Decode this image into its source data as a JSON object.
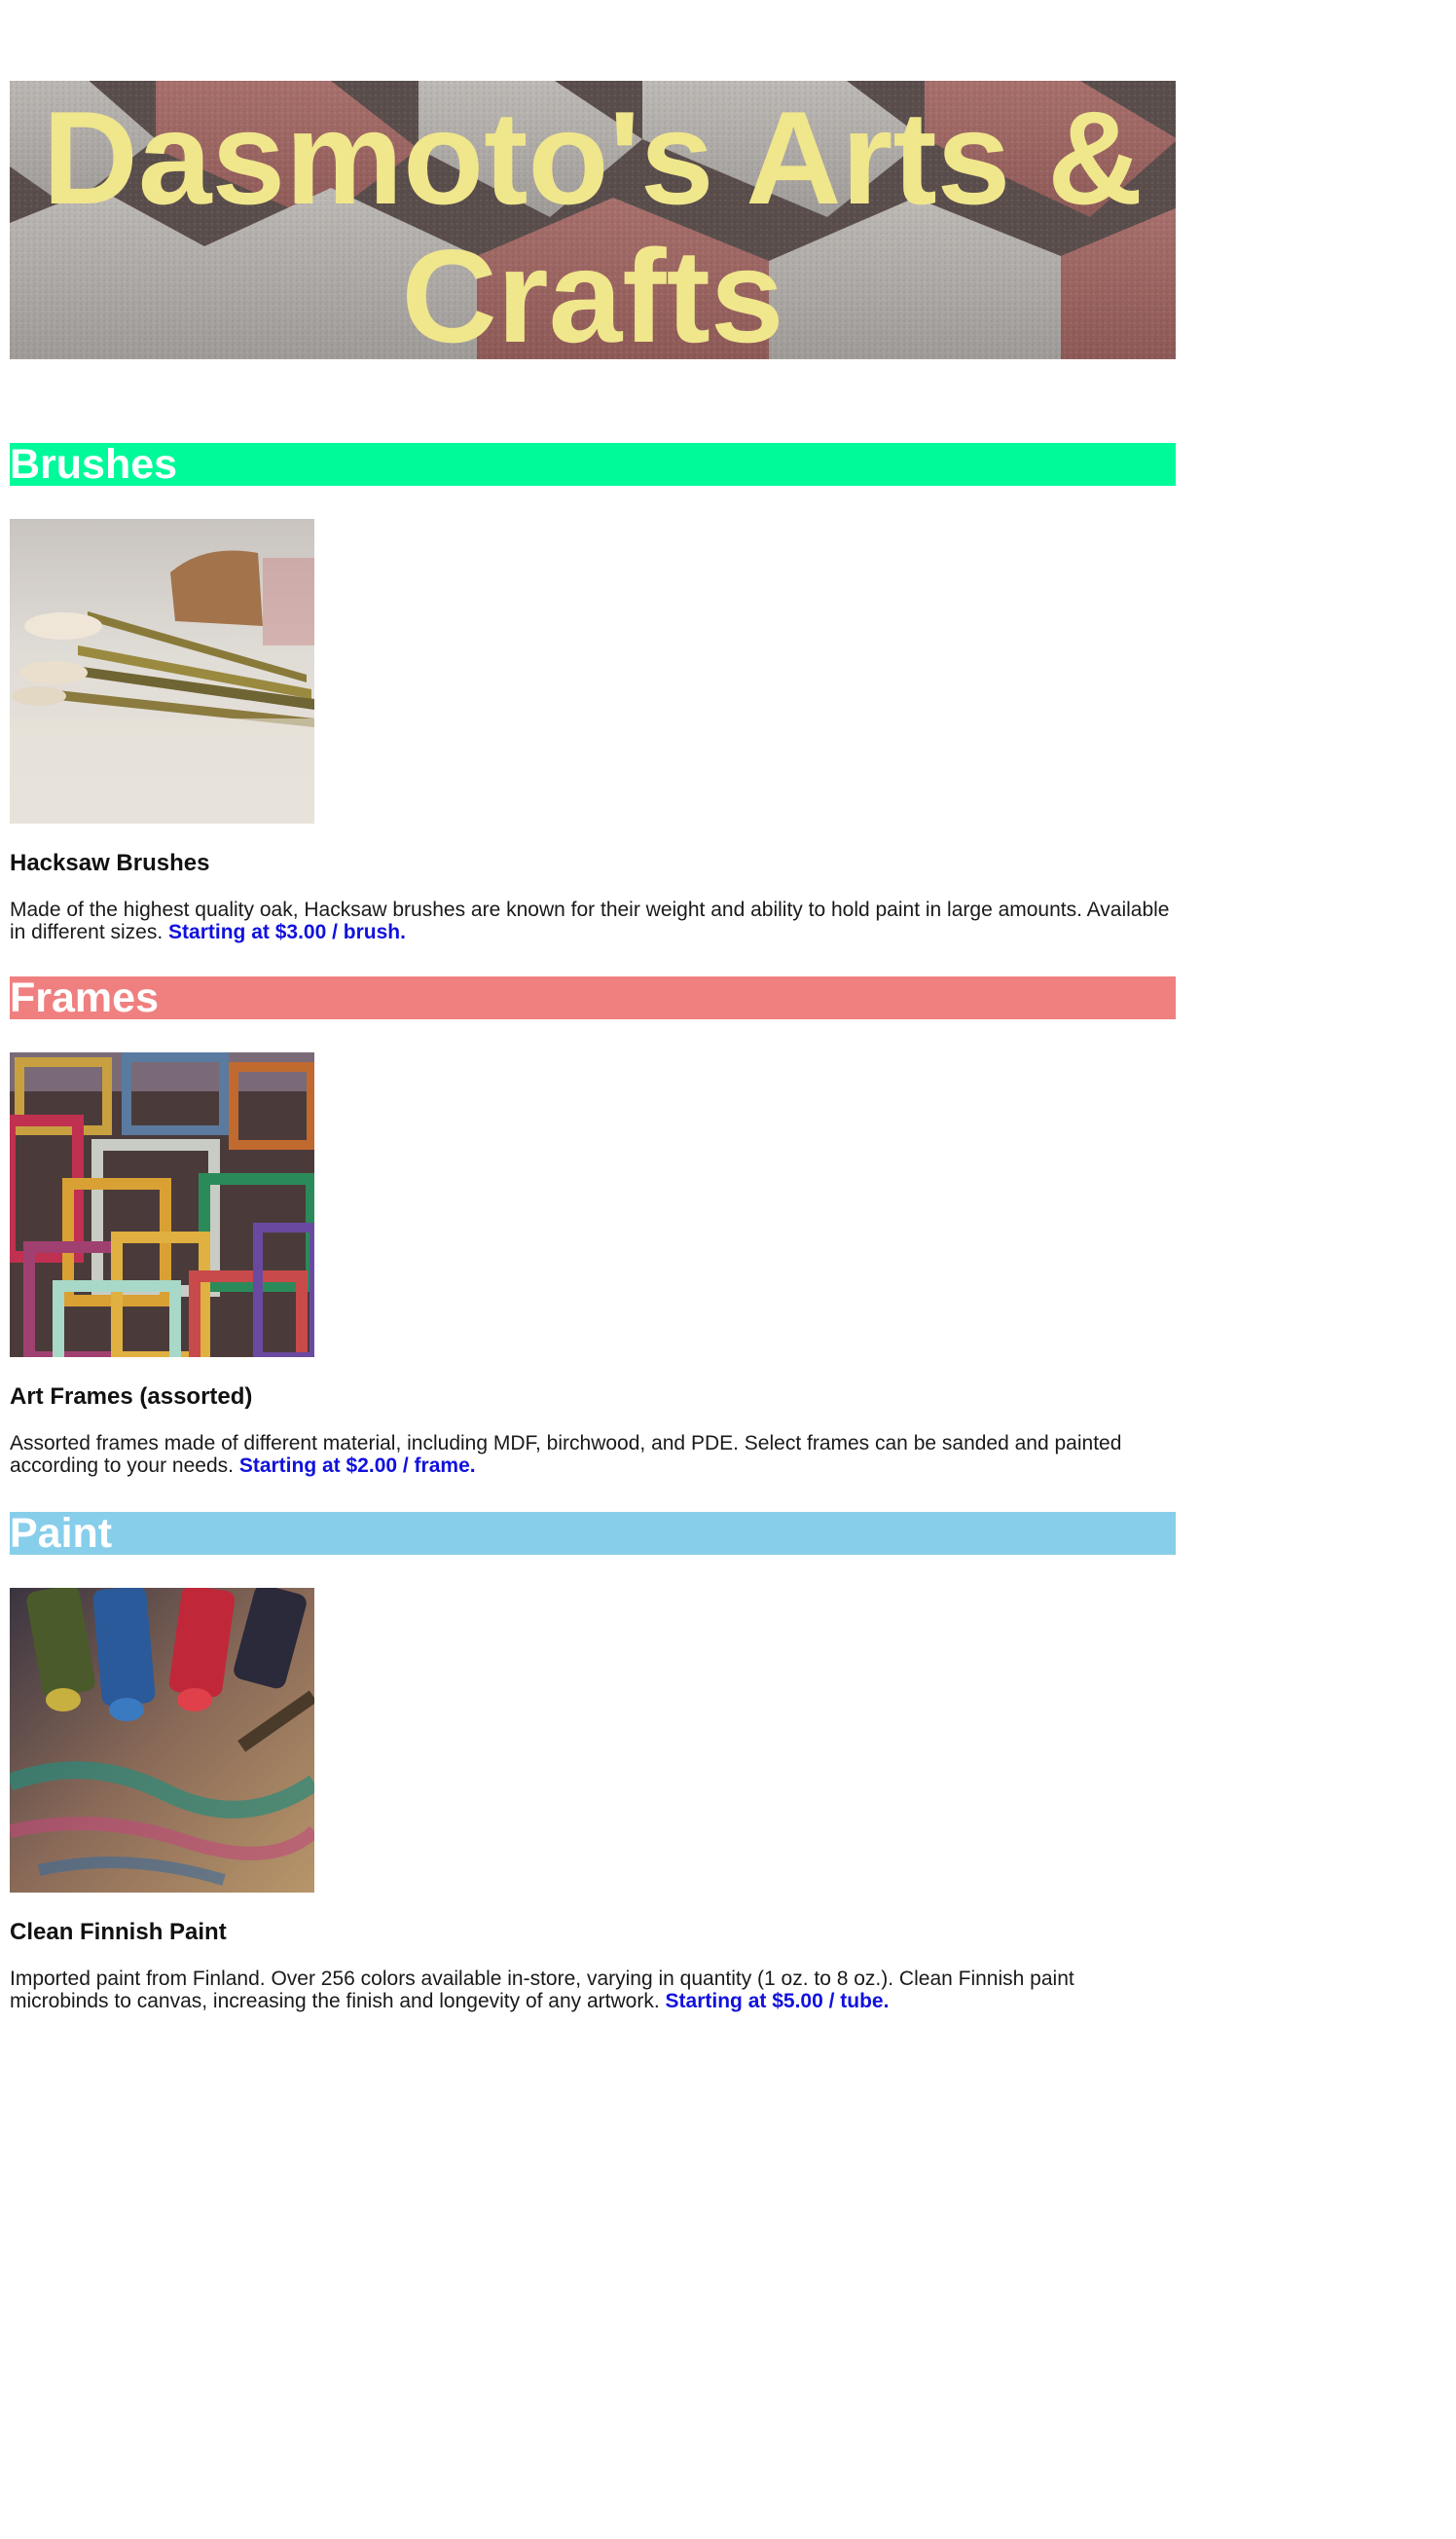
{
  "header": {
    "title": "Dasmoto's Arts & Crafts",
    "title_color": "#f0e68c"
  },
  "sections": [
    {
      "heading": "Brushes",
      "color": "#00fa9a",
      "image_subject": "brushes-photo",
      "item_title": "Hacksaw Brushes",
      "description": "Made of the highest quality oak, Hacksaw brushes are known for their weight and ability to hold paint in large amounts. Available in different sizes.",
      "price": "Starting at $3.00 / brush."
    },
    {
      "heading": "Frames",
      "color": "#f08080",
      "image_subject": "frames-photo",
      "item_title": "Art Frames (assorted)",
      "description": "Assorted frames made of different material, including MDF, birchwood, and PDE. Select frames can be sanded and painted according to your needs.",
      "price": "Starting at $2.00 / frame."
    },
    {
      "heading": "Paint",
      "color": "#87ceeb",
      "image_subject": "paint-photo",
      "item_title": "Clean Finnish Paint",
      "description": "Imported paint from Finland. Over 256 colors available in-store, varying in quantity (1 oz. to 8 oz.). Clean Finnish paint microbinds to canvas, increasing the finish and longevity of any artwork.",
      "price": "Starting at $5.00 / tube."
    }
  ],
  "price_color": "#1111dd"
}
